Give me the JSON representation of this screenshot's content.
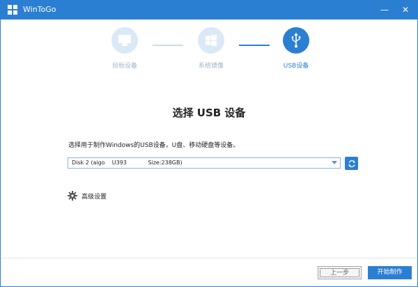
{
  "window": {
    "title": "WinToGo",
    "minimize_glyph": "—",
    "close_glyph": "✕"
  },
  "steps": [
    {
      "label": "目标设备",
      "icon": "monitor-icon",
      "state": "inactive"
    },
    {
      "label": "系统镜像",
      "icon": "windows-icon",
      "state": "inactive"
    },
    {
      "label": "USB设备",
      "icon": "usb-icon",
      "state": "active"
    }
  ],
  "main": {
    "heading": "选择 USB 设备",
    "description": "选择用于制作Windows的USB设备，U盘、移动硬盘等设备。",
    "device_select": {
      "value": "Disk 2 (aigo    U393            Size:238GB)"
    },
    "advanced_label": "高级设置"
  },
  "footer": {
    "prev_label": "上一步",
    "start_label": "开始制作"
  },
  "colors": {
    "accent": "#2b7fd3",
    "inactive_step": "#dbe8f6",
    "inactive_text": "#9fb3c9"
  }
}
